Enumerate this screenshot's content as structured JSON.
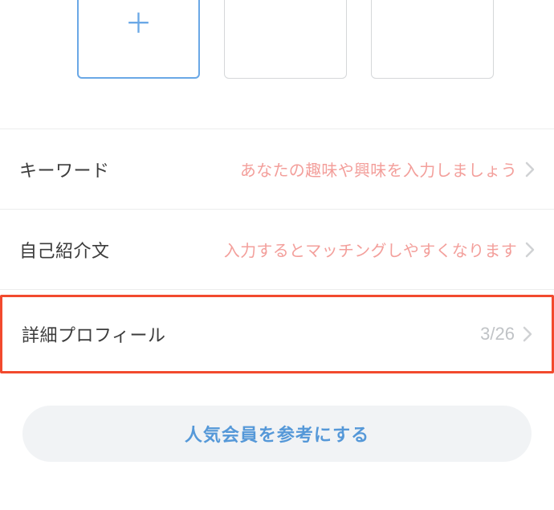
{
  "photos": {
    "add_slot": true
  },
  "list": [
    {
      "label": "キーワード",
      "right_text": "あなたの趣味や興味を入力しましょう",
      "highlight": false,
      "show_pink": true
    },
    {
      "label": "自己紹介文",
      "right_text": "入力するとマッチングしやすくなります",
      "highlight": false,
      "show_pink": true
    },
    {
      "label": "詳細プロフィール",
      "right_text": "3/26",
      "highlight": true,
      "show_pink": false
    }
  ],
  "bottom_button": {
    "label": "人気会員を参考にする"
  }
}
